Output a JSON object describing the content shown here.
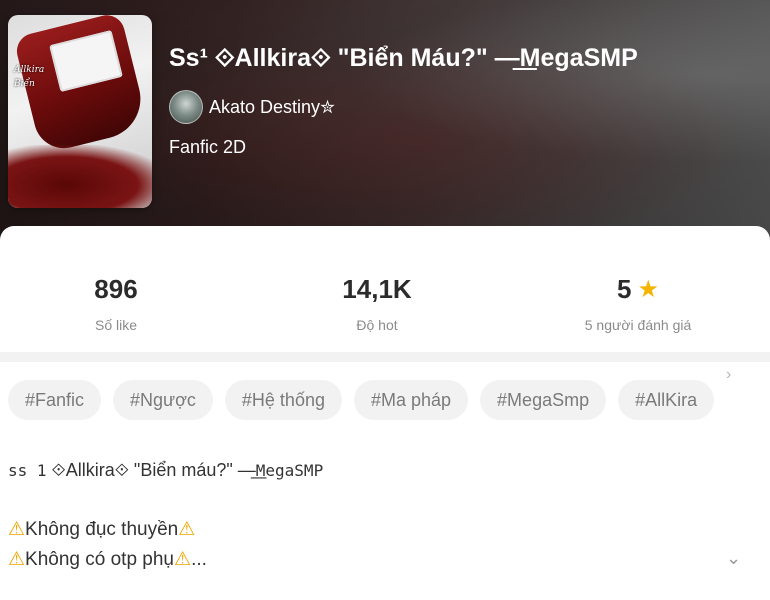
{
  "story": {
    "title": "Ss¹ ⟐Allkira⟐ \"Biển Máu?\" —͟MegaSMP",
    "author": "Akato Destiny✮",
    "category": "Fanfic 2D",
    "cover_text_1": "Allkira",
    "cover_text_2": "Biển"
  },
  "stats": {
    "likes_value": "896",
    "likes_label": "Số like",
    "hot_value": "14,1K",
    "hot_label": "Độ hot",
    "rating_value": "5",
    "rating_label": "5 người đánh giá"
  },
  "tags": [
    "#Fanfic",
    "#Ngược",
    "#Hệ thống",
    "#Ma pháp",
    "#MegaSmp",
    "#AllKira"
  ],
  "description": {
    "title_prefix": "ss 1",
    "title_rest": "⟐Allkira⟐ \"Biển máu?\" —͟",
    "title_suffix": "MegaSMP",
    "line1_text": "Không đục thuyền",
    "line2_text": "Không có otp phụ",
    "line2_ellipsis": "..."
  },
  "icons": {
    "star": "star-icon",
    "warning": "warning-icon",
    "chevron_right": "chevron-right-icon",
    "chevron_down": "chevron-down-icon"
  },
  "colors": {
    "star": "#f5b400",
    "warning": "#f0a500",
    "tag_bg": "#f2f2f2"
  }
}
